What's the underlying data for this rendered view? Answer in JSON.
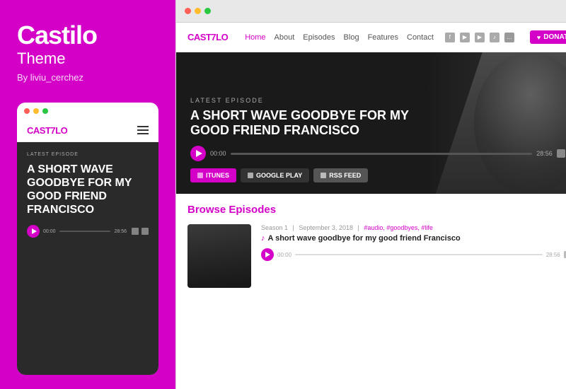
{
  "brand": {
    "title": "Castilo",
    "subtitle": "Theme",
    "author": "By liviu_cerchez"
  },
  "mobile_mockup": {
    "logo": "CAST",
    "logo_separator": "7",
    "logo_suffix": "LO",
    "episode_label": "LATEST EPISODE",
    "episode_title": "A SHORT WAVE GOODBYE FOR MY GOOD FRIEND FRANCISCO",
    "time_start": "00:00",
    "time_end": "28:56"
  },
  "site": {
    "logo": "CAST",
    "logo_separator": "7",
    "logo_suffix": "LO",
    "nav": {
      "home": "Home",
      "about": "About",
      "episodes": "Episodes",
      "blog": "Blog",
      "features": "Features",
      "contact": "Contact"
    },
    "donate_label": "DONATE"
  },
  "hero": {
    "episode_label": "LATEST EPISODE",
    "episode_title": "A SHORT WAVE GOODBYE FOR MY GOOD FRIEND FRANCISCO",
    "time_start": "00:00",
    "time_end": "28:56",
    "btn_itunes": "ITUNES",
    "btn_google": "GOOGLE PLAY",
    "btn_rss": "RSS FEED"
  },
  "browse": {
    "heading_normal": "Browse",
    "heading_accent": "Episodes",
    "episode": {
      "season": "Season 1",
      "date": "September 3, 2018",
      "tags": "#audio, #goodbyes, #life",
      "title": "A short wave goodbye for my good friend Francisco",
      "time_start": "00:00",
      "time_end": "28:56"
    }
  }
}
